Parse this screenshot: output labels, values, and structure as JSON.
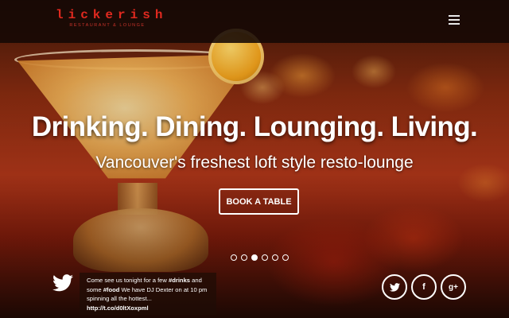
{
  "header": {
    "logo_word": "lickerish",
    "logo_tagline": "RESTAURANT & LOUNGE",
    "menu_icon": "hamburger-menu-icon"
  },
  "hero": {
    "headline": "Drinking. Dining. Lounging. Living.",
    "subheadline": "Vancouver's freshest loft style resto-lounge",
    "cta_label": "BOOK A TABLE",
    "slide_count": 6,
    "active_slide": 3
  },
  "tweet": {
    "icon": "twitter-bird-icon",
    "part1": "Come see us tonight for a few ",
    "tag1": "#drinks",
    "part2": " and some ",
    "tag2": "#food",
    "part3": " We have DJ Dexter on at 10 pm spinning all the hottest...",
    "link": "http://t.co/d0ltXoxpml"
  },
  "social": {
    "twitter_glyph": "t",
    "facebook_glyph": "f",
    "googleplus_glyph": "g+"
  },
  "colors": {
    "brand_red": "#e0291f",
    "text": "#ffffff"
  }
}
